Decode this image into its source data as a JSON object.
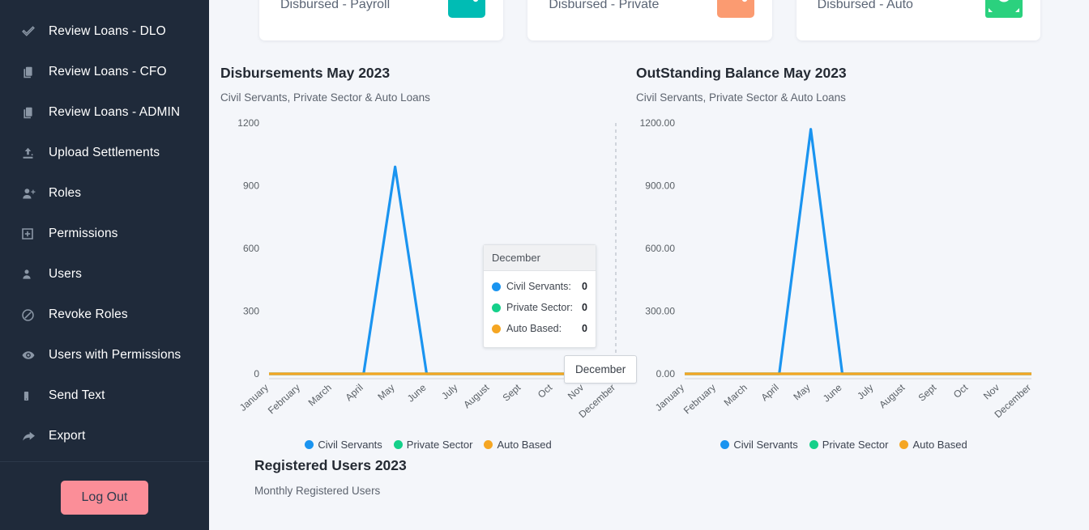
{
  "sidebar": {
    "items": [
      {
        "label": "Review Loans - DLO",
        "icon": "check-icon"
      },
      {
        "label": "Review Loans - CFO",
        "icon": "copy-icon"
      },
      {
        "label": "Review Loans - ADMIN",
        "icon": "copy-icon"
      },
      {
        "label": "Upload Settlements",
        "icon": "upload-icon"
      },
      {
        "label": "Roles",
        "icon": "user-plus-icon"
      },
      {
        "label": "Permissions",
        "icon": "plus-square-icon"
      },
      {
        "label": "Users",
        "icon": "user-icon"
      },
      {
        "label": "Revoke Roles",
        "icon": "ban-icon"
      },
      {
        "label": "Users with Permissions",
        "icon": "eye-icon"
      },
      {
        "label": "Send Text",
        "icon": "mobile-icon"
      },
      {
        "label": "Export",
        "icon": "share-arrow-icon"
      }
    ],
    "logout_label": "Log Out",
    "bg_color": "#1f2a3a",
    "logout_color": "#fb8e98"
  },
  "cards": [
    {
      "title": "Disbursed - Payroll",
      "icon": "wallet-icon",
      "color": "#00bcb4"
    },
    {
      "title": "Disbursed - Private",
      "icon": "wallet-icon",
      "color": "#fb9b71"
    },
    {
      "title": "Disbursed - Auto",
      "icon": "money-icon",
      "color": "#2bd17e"
    }
  ],
  "colors": {
    "civil_servants": "#1a94f0",
    "private_sector": "#15d08a",
    "auto_based": "#f5a623",
    "axis_line": "#d4b106"
  },
  "tooltip": {
    "title": "December",
    "rows": [
      {
        "label": "Civil Servants:",
        "value": "0",
        "color": "#1a94f0"
      },
      {
        "label": "Private Sector:",
        "value": "0",
        "color": "#15d08a"
      },
      {
        "label": "Auto Based:",
        "value": "0",
        "color": "#f5a623"
      }
    ]
  },
  "axis_tooltip": {
    "label": "December"
  },
  "bottom": {
    "title": "Registered Users 2023",
    "subtitle": "Monthly Registered Users"
  },
  "chart_data": [
    {
      "type": "line",
      "title": "Disbursements May 2023",
      "subtitle": "Civil Servants, Private Sector & Auto Loans",
      "xlabel": "",
      "ylabel": "",
      "ylim": [
        0,
        1200
      ],
      "yticks": [
        "0",
        "300",
        "600",
        "900",
        "1200"
      ],
      "ytick_values": [
        0,
        300,
        600,
        900,
        1200
      ],
      "grid": false,
      "legend_position": "bottom",
      "categories": [
        "January",
        "February",
        "March",
        "April",
        "May",
        "June",
        "July",
        "August",
        "Sept",
        "Oct",
        "Nov",
        "December"
      ],
      "series": [
        {
          "name": "Civil Servants",
          "color": "#1a94f0",
          "values": [
            0,
            0,
            0,
            0,
            990,
            0,
            0,
            0,
            0,
            0,
            0,
            0
          ]
        },
        {
          "name": "Private Sector",
          "color": "#15d08a",
          "values": [
            0,
            0,
            0,
            0,
            0,
            0,
            0,
            0,
            0,
            0,
            0,
            0
          ]
        },
        {
          "name": "Auto Based",
          "color": "#f5a623",
          "values": [
            0,
            0,
            0,
            0,
            0,
            0,
            0,
            0,
            0,
            0,
            0,
            0
          ]
        }
      ]
    },
    {
      "type": "line",
      "title": "OutStanding Balance May 2023",
      "subtitle": "Civil Servants, Private Sector & Auto Loans",
      "xlabel": "",
      "ylabel": "",
      "ylim": [
        0,
        1200
      ],
      "yticks": [
        "0.00",
        "300.00",
        "600.00",
        "900.00",
        "1200.00"
      ],
      "ytick_values": [
        0,
        300,
        600,
        900,
        1200
      ],
      "grid": false,
      "legend_position": "bottom",
      "categories": [
        "January",
        "February",
        "March",
        "April",
        "May",
        "June",
        "July",
        "August",
        "Sept",
        "Oct",
        "Nov",
        "December"
      ],
      "series": [
        {
          "name": "Civil Servants",
          "color": "#1a94f0",
          "values": [
            0,
            0,
            0,
            0,
            1170,
            0,
            0,
            0,
            0,
            0,
            0,
            0
          ]
        },
        {
          "name": "Private Sector",
          "color": "#15d08a",
          "values": [
            0,
            0,
            0,
            0,
            0,
            0,
            0,
            0,
            0,
            0,
            0,
            0
          ]
        },
        {
          "name": "Auto Based",
          "color": "#f5a623",
          "values": [
            0,
            0,
            0,
            0,
            0,
            0,
            0,
            0,
            0,
            0,
            0,
            0
          ]
        }
      ]
    }
  ]
}
